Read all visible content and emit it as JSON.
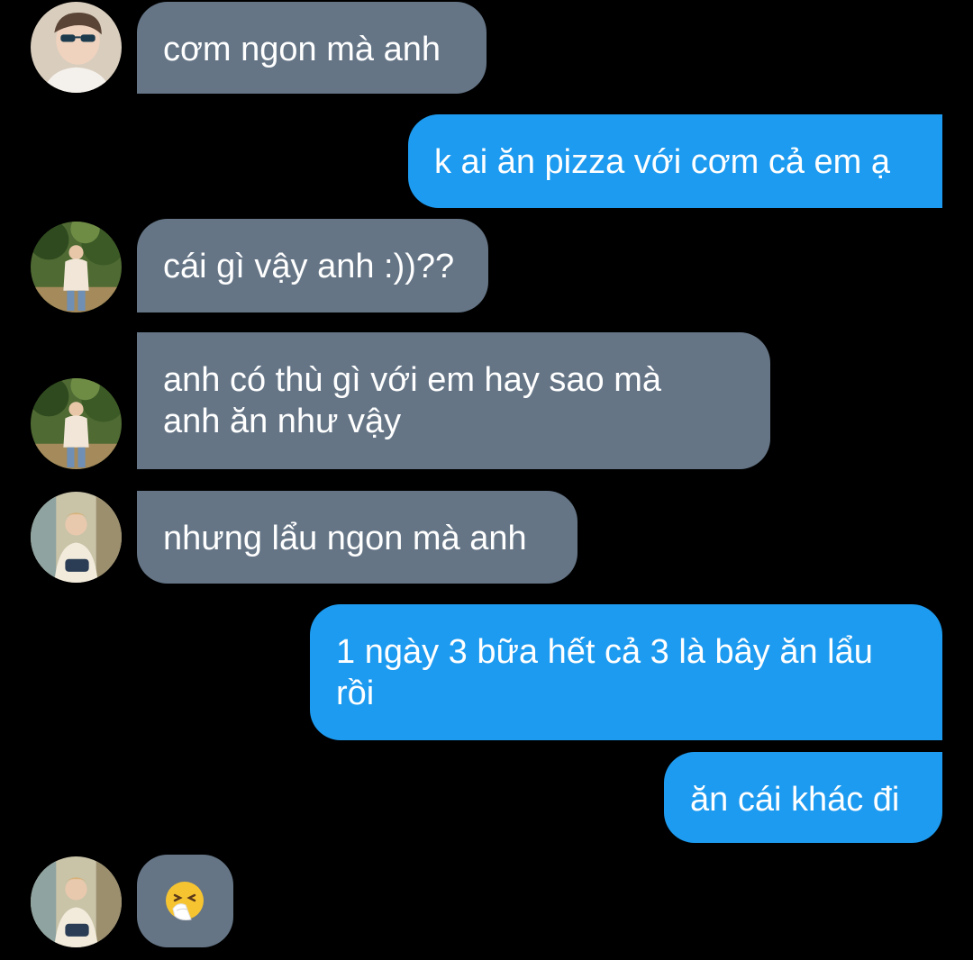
{
  "messages": [
    {
      "side": "in",
      "text": "cơm ngon mà anh"
    },
    {
      "side": "out",
      "text": "k ai ăn pizza với cơm cả em ạ"
    },
    {
      "side": "in",
      "text": "cái gì vậy anh :))??"
    },
    {
      "side": "in",
      "lines": [
        "anh có thù gì với em hay sao mà",
        "anh ăn như vậy"
      ]
    },
    {
      "side": "in",
      "text": "nhưng lẩu ngon mà anh"
    },
    {
      "side": "out",
      "lines": [
        "1 ngày 3 bữa hết cả 3 là bây ăn lẩu",
        "rồi"
      ]
    },
    {
      "side": "out",
      "text": "ăn cái khác đi"
    },
    {
      "side": "in",
      "emoji": "sneezing-face"
    }
  ],
  "colors": {
    "background": "#000000",
    "incoming_bubble": "#657586",
    "outgoing_bubble": "#1d9bf0",
    "text": "#ffffff"
  }
}
